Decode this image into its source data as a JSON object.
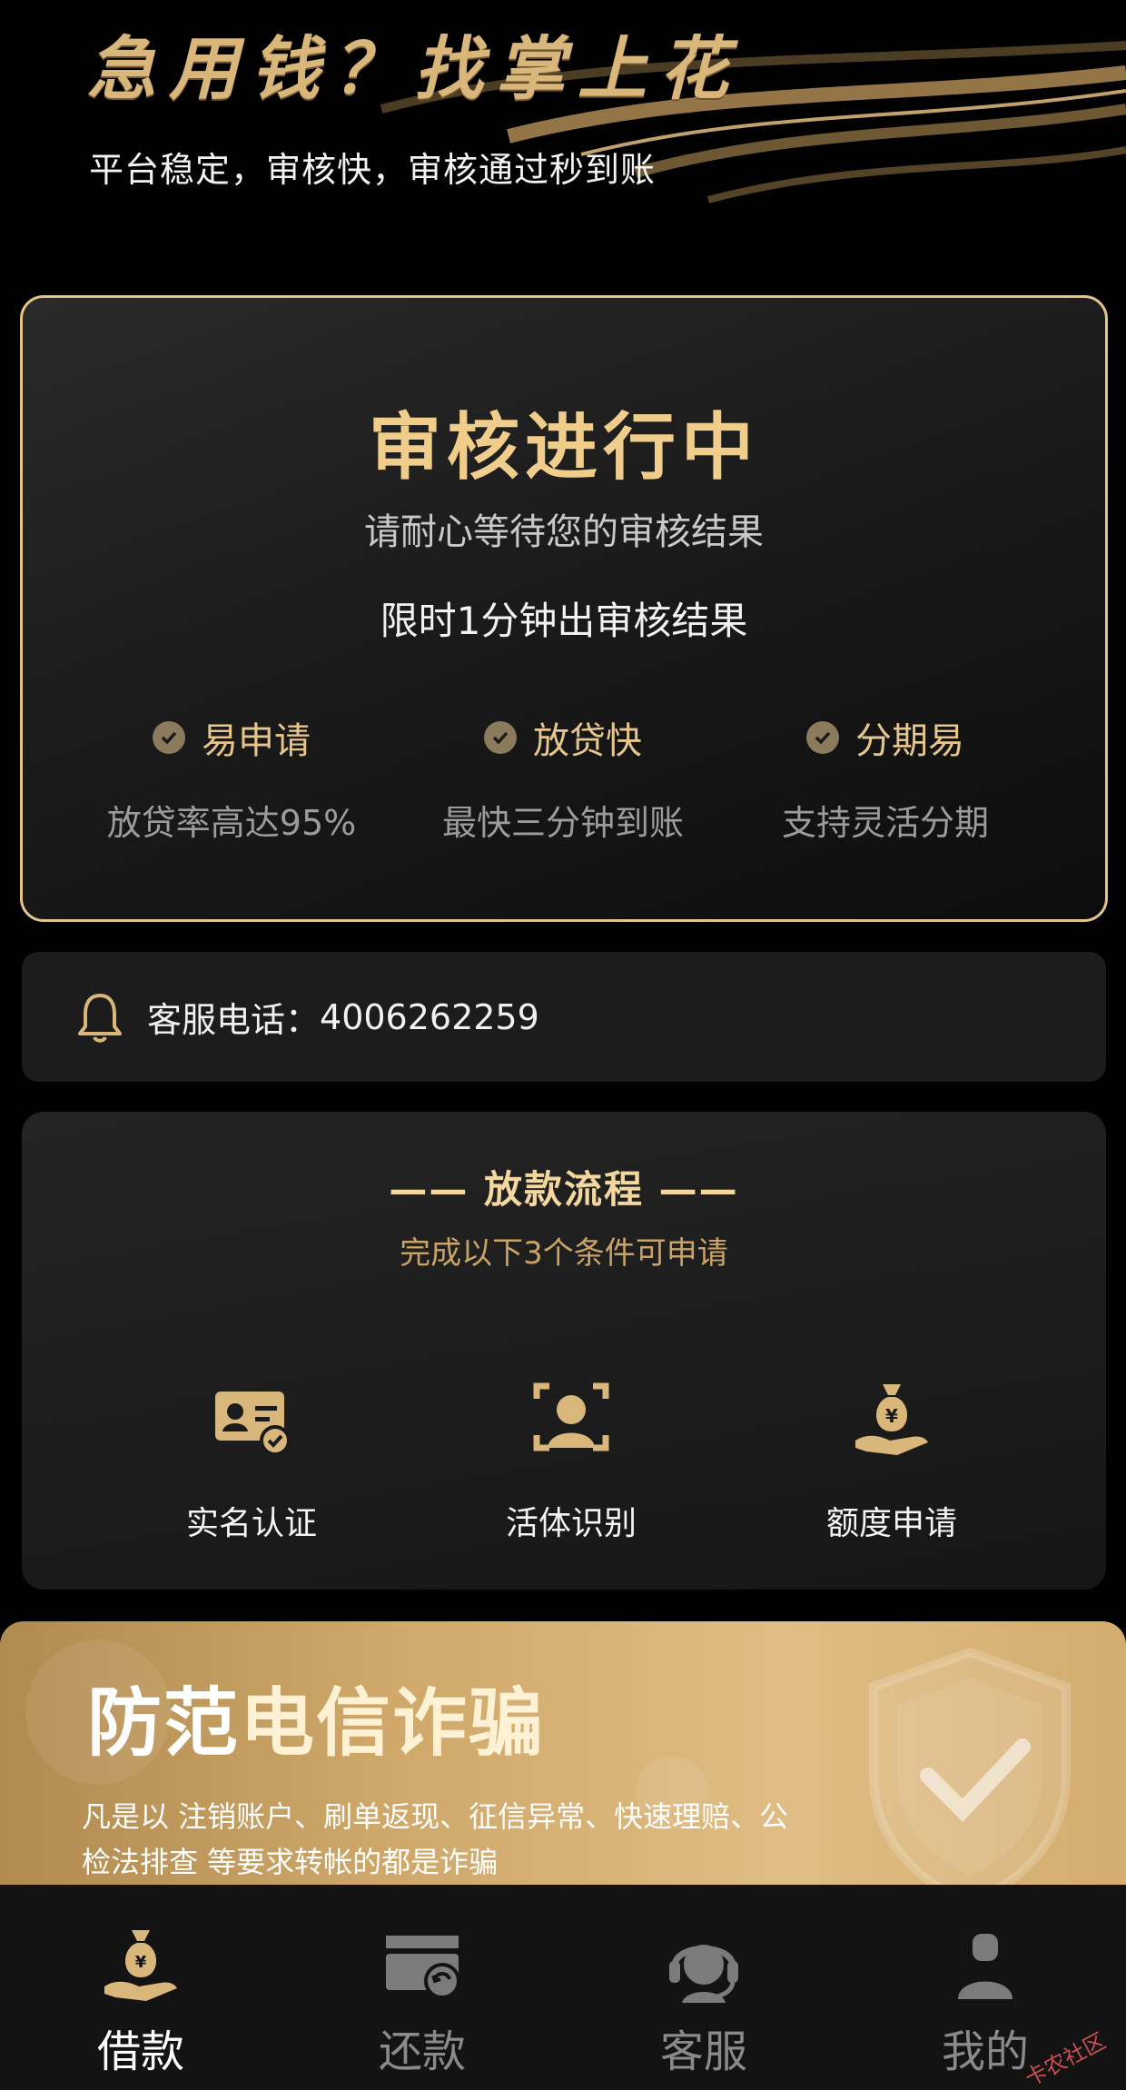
{
  "hero": {
    "title": "急用钱？找掌上花",
    "subtitle": "平台稳定，审核快，审核通过秒到账"
  },
  "status": {
    "title": "审核进行中",
    "subtitle": "请耐心等待您的审核结果",
    "limit_text": "限时1分钟出审核结果",
    "features": [
      {
        "label": "易申请",
        "desc": "放贷率高达95%"
      },
      {
        "label": "放贷快",
        "desc": "最快三分钟到账"
      },
      {
        "label": "分期易",
        "desc": "支持灵活分期"
      }
    ]
  },
  "service": {
    "label": "客服电话：",
    "phone": "4006262259"
  },
  "process": {
    "title": "—— 放款流程 ——",
    "subtitle": "完成以下3个条件可申请",
    "steps": [
      {
        "label": "实名认证",
        "icon": "id-card-check-icon"
      },
      {
        "label": "活体识别",
        "icon": "face-scan-icon"
      },
      {
        "label": "额度申请",
        "icon": "money-bag-hand-icon"
      }
    ]
  },
  "fraud": {
    "title_a": "防范",
    "title_b": "电信诈骗",
    "text": "凡是以 注销账户、刷单返现、征信异常、快速理赔、公检法排查 等要求转帐的都是诈骗"
  },
  "nav": {
    "items": [
      {
        "label": "借款",
        "icon": "money-bag-icon",
        "active": true
      },
      {
        "label": "还款",
        "icon": "card-return-icon",
        "active": false
      },
      {
        "label": "客服",
        "icon": "headset-icon",
        "active": false
      },
      {
        "label": "我的",
        "icon": "user-icon",
        "active": false
      }
    ]
  },
  "watermark": "卡农社区",
  "colors": {
    "gold": "#e3c489",
    "gold_text": "#f0cd8a",
    "background": "#000000"
  }
}
